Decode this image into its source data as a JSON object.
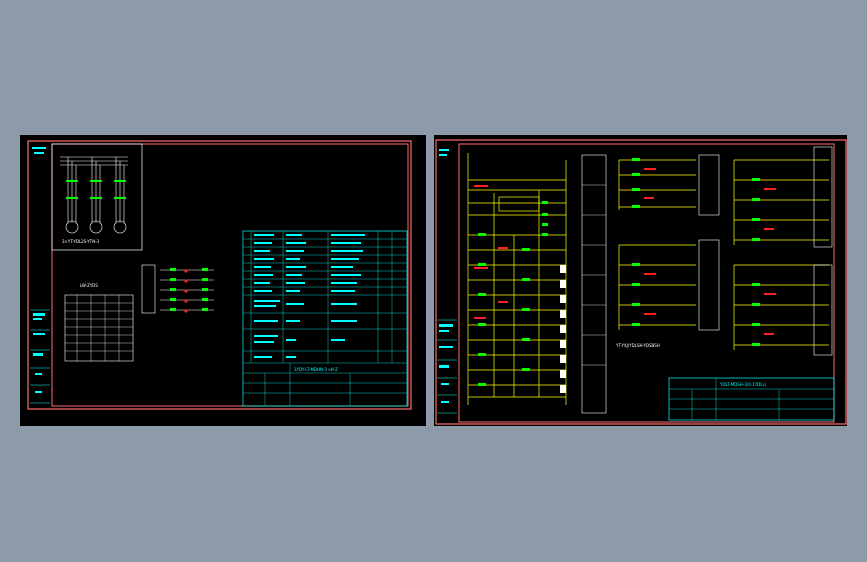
{
  "colors": {
    "background": "#8d9aaa",
    "sheet": "#000000",
    "frame": "#ff6d6d",
    "table": "#00ffff",
    "wire": "#ffff00",
    "component": "#00ff00",
    "marker": "#ff2020",
    "white": "#ffffff"
  },
  "left_sheet": {
    "motor_caption": "3×YT-YDL2S-YTN-3",
    "selector_caption": "LW-ZYDS",
    "title_block_title": "3YDY-LT-MDHN-3 xH-Z"
  },
  "right_sheet": {
    "note": "YT-YXJ/YDLSH-YDSBSH",
    "title_block_title": "YDLT-MDSH-3(0.1YDLL)"
  }
}
